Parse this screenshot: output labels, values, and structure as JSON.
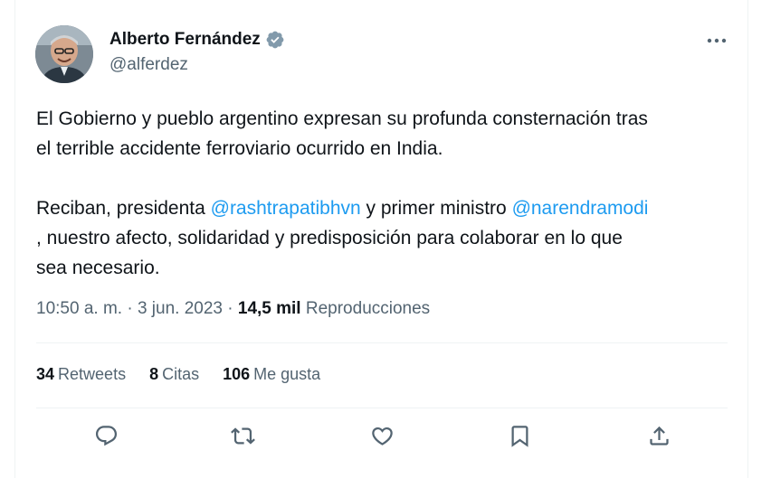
{
  "author": {
    "name": "Alberto Fernández",
    "handle": "@alferdez",
    "verified_icon": "verified-badge-icon",
    "badge_color": "#829aab"
  },
  "tweet": {
    "line1": "El Gobierno y pueblo argentino expresan su profunda consternación tras",
    "line2": "el terrible accidente ferroviario ocurrido en India.",
    "para2_prefix": "Reciban, presidenta ",
    "mention1": "@rashtrapatibhvn",
    "para2_middle": " y primer ministro ",
    "mention2": "@narendramodi",
    "line_c": ", nuestro afecto, solidaridad y predisposición para colaborar en lo que",
    "line_d": "sea necesario."
  },
  "meta": {
    "time": "10:50 a. m.",
    "sep1": " · ",
    "date": "3 jun. 2023",
    "sep2": " · ",
    "views": "14,5 mil",
    "views_label": " Reproducciones"
  },
  "stats": {
    "retweets_count": "34",
    "retweets_label": "Retweets",
    "quotes_count": "8",
    "quotes_label": "Citas",
    "likes_count": "106",
    "likes_label": "Me gusta"
  },
  "actions": {
    "reply_icon": "reply-icon",
    "retweet_icon": "retweet-icon",
    "like_icon": "heart-icon",
    "bookmark_icon": "bookmark-icon",
    "share_icon": "share-icon"
  },
  "colors": {
    "text": "#0f1419",
    "secondary": "#536471",
    "link": "#1d9bf0",
    "divider": "#eff3f4"
  }
}
